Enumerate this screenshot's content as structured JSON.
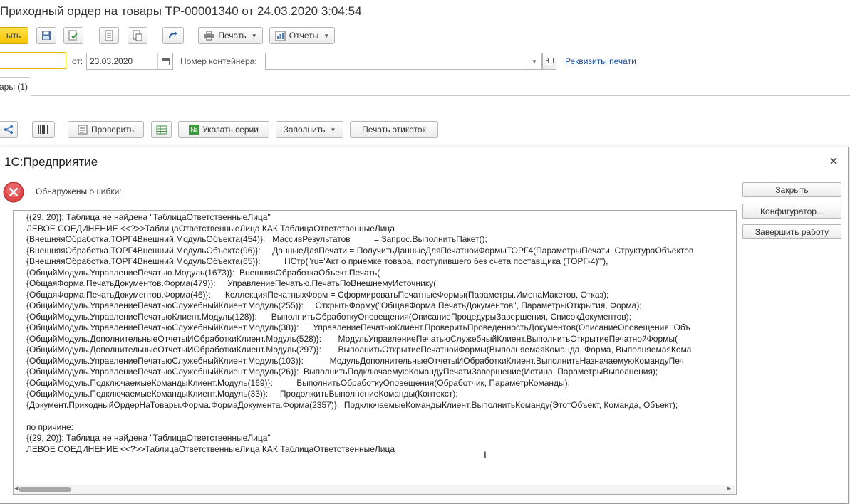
{
  "window": {
    "title": "Приходный ордер на товары ТР-00001340 от 24.03.2020 3:04:54"
  },
  "toolbar": {
    "post_close_label": "ыть",
    "print_label": "Печать",
    "reports_label": "Отчеты"
  },
  "form": {
    "date_label": "от:",
    "date_value": "23.03.2020",
    "container_label": "Номер контейнера:",
    "container_value": "",
    "print_details_link": "Реквизиты печати"
  },
  "tabs": [
    {
      "label": "ары (1)"
    }
  ],
  "goods_toolbar": {
    "check_label": "Проверить",
    "series_label": "Указать серии",
    "fill_label": "Заполнить",
    "labels_print_label": "Печать этикеток"
  },
  "dialog": {
    "title": "1С:Предприятие",
    "message": "Обнаружены ошибки:",
    "close_button": "Закрыть",
    "configurator_button": "Конфигуратор...",
    "exit_button": "Завершить работу",
    "error_lines": [
      "{(29, 20)}: Таблица не найдена \"ТаблицаОтветственныеЛица\"",
      "ЛЕВОЕ СОЕДИНЕНИЕ <<?>>ТаблицаОтветственныеЛица КАК ТаблицаОтветственныеЛица",
      "{ВнешняяОбработка.ТОРГ4Внешний.МодульОбъекта(454)}:   МассивРезультатов          = Запрос.ВыполнитьПакет();",
      "{ВнешняяОбработка.ТОРГ4Внешний.МодульОбъекта(96)}:     ДанныеДляПечати = ПолучитьДанныеДляПечатнойФормыТОРГ4(ПараметрыПечати, СтруктураОбъектов",
      "{ВнешняяОбработка.ТОРГ4Внешний.МодульОбъекта(65)}:          НСтр(\"ru='Акт о приемке товара, поступившего без счета поставщика (ТОРГ-4)'\"),",
      "{ОбщийМодуль.УправлениеПечатью.Модуль(1673)}:  ВнешняяОбработкаОбъект.Печать(",
      "{ОбщаяФорма.ПечатьДокументов.Форма(479)}:     УправлениеПечатью.ПечатьПоВнешнемуИсточнику(",
      "{ОбщаяФорма.ПечатьДокументов.Форма(46)}:      КоллекцияПечатныхФорм = СформироватьПечатныеФормы(Параметры.ИменаМакетов, Отказ);",
      "{ОбщийМодуль.УправлениеПечатьюСлужебныйКлиент.Модуль(255)}:     ОткрытьФорму(\"ОбщаяФорма.ПечатьДокументов\", ПараметрыОткрытия, Форма);",
      "{ОбщийМодуль.УправлениеПечатьюКлиент.Модуль(128)}:      ВыполнитьОбработкуОповещения(ОписаниеПроцедурыЗавершения, СписокДокументов);",
      "{ОбщийМодуль.УправлениеПечатьюСлужебныйКлиент.Модуль(38)}:      УправлениеПечатьюКлиент.ПроверитьПроведенностьДокументов(ОписаниеОповещения, Объ",
      "{ОбщийМодуль.ДополнительныеОтчетыИОбработкиКлиент.Модуль(528)}:       МодульУправлениеПечатьюСлужебныйКлиент.ВыполнитьОткрытиеПечатнойФормы(",
      "{ОбщийМодуль.ДополнительныеОтчетыИОбработкиКлиент.Модуль(297)}:       ВыполнитьОткрытиеПечатнойФормы(ВыполняемаяКоманда, Форма, ВыполняемаяКома",
      "{ОбщийМодуль.УправлениеПечатьюСлужебныйКлиент.Модуль(103)}:           МодульДополнительныеОтчетыИОбработкиКлиент.ВыполнитьНазначаемуюКомандуПеч",
      "{ОбщийМодуль.УправлениеПечатьюСлужебныйКлиент.Модуль(26)}:  ВыполнитьПодключаемуюКомандуПечатиЗавершение(Истина, ПараметрыВыполнения);",
      "{ОбщийМодуль.ПодключаемыеКомандыКлиент.Модуль(169)}:          ВыполнитьОбработкуОповещения(Обработчик, ПараметрКоманды);",
      "{ОбщийМодуль.ПодключаемыеКомандыКлиент.Модуль(33)}:     ПродолжитьВыполнениеКоманды(Контекст);",
      "{Документ.ПриходныйОрдерНаТовары.Форма.ФормаДокумента.Форма(2357)}:  ПодключаемыеКомандыКлиент.ВыполнитьКоманду(ЭтотОбъект, Команда, Объект);",
      "",
      "по причине:",
      "{(29, 20)}: Таблица не найдена \"ТаблицаОтветственныеЛица\"",
      "ЛЕВОЕ СОЕДИНЕНИЕ <<?>>ТаблицаОтветственныеЛица КАК ТаблицаОтветственныеЛица"
    ]
  },
  "colors": {
    "accent_yellow": "#f5c400",
    "link_blue": "#1a4fa0",
    "error_red": "#e0484a"
  }
}
